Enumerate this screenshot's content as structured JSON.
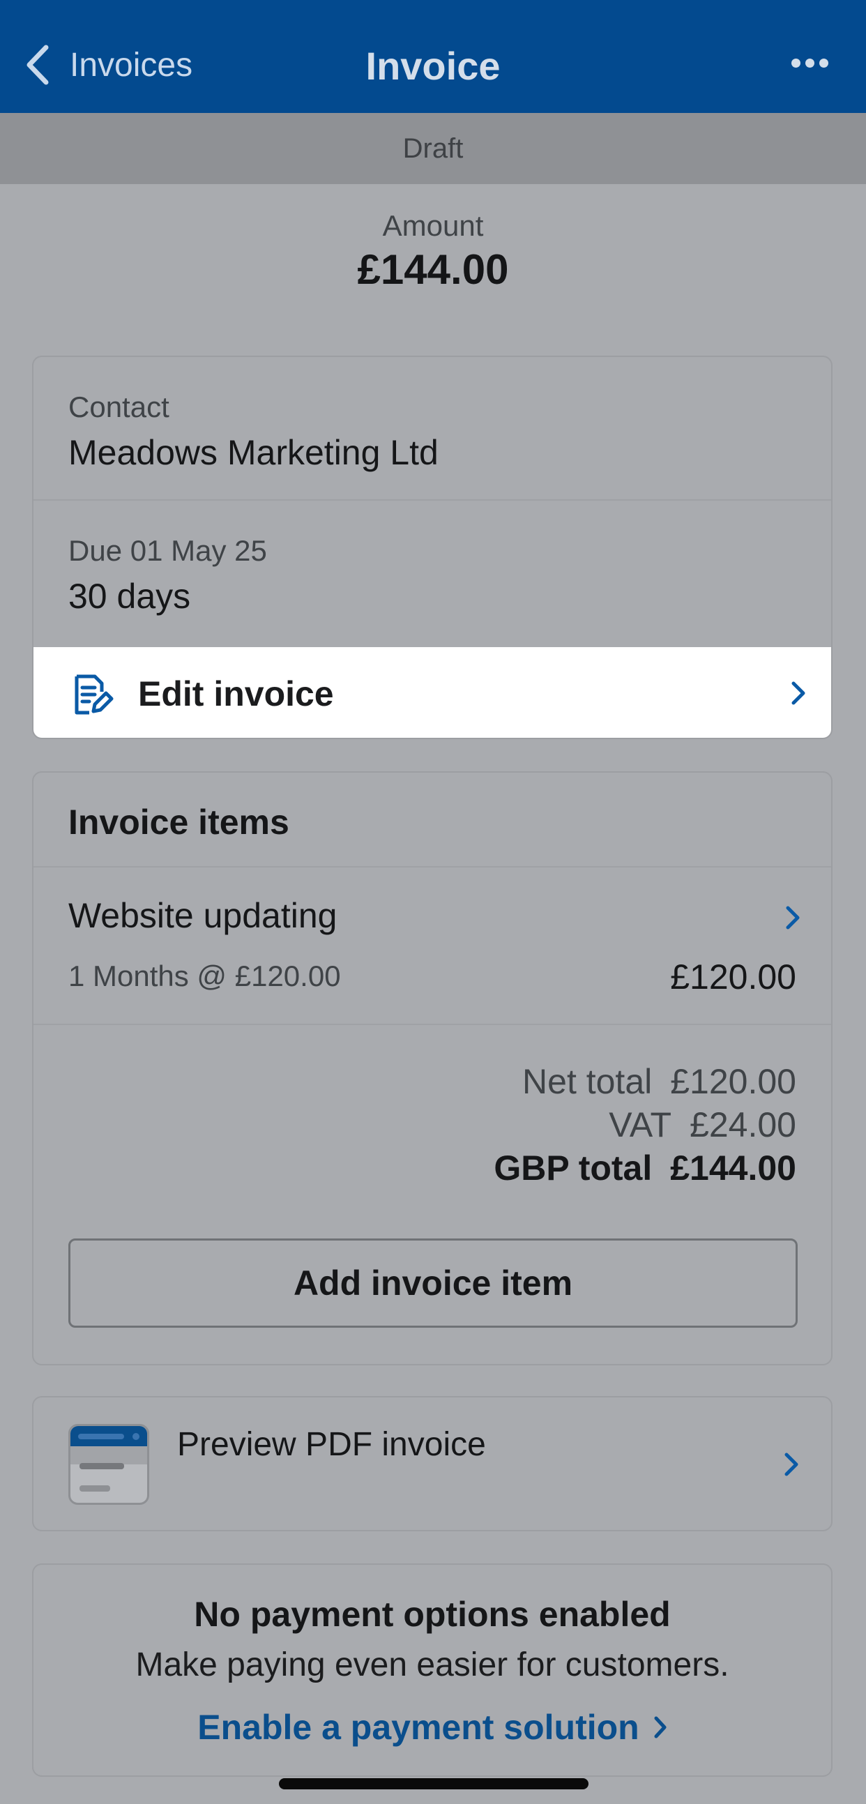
{
  "nav": {
    "back_label": "Invoices",
    "title": "Invoice"
  },
  "status": "Draft",
  "amount": {
    "label": "Amount",
    "value": "£144.00"
  },
  "contact": {
    "label": "Contact",
    "value": "Meadows Marketing Ltd"
  },
  "due": {
    "label": "Due 01 May 25",
    "value": "30 days"
  },
  "edit_invoice_label": "Edit invoice",
  "items": {
    "title": "Invoice items",
    "list": [
      {
        "name": "Website updating",
        "detail": "1 Months @ £120.00",
        "amount": "£120.00"
      }
    ],
    "totals": {
      "net_label": "Net total",
      "net_value": "£120.00",
      "vat_label": "VAT",
      "vat_value": "£24.00",
      "gbp_label": "GBP total",
      "gbp_value": "£144.00"
    },
    "add_button": "Add invoice item"
  },
  "preview_label": "Preview PDF invoice",
  "payment": {
    "title": "No payment options enabled",
    "subtitle": "Make paying even easier for customers.",
    "link": "Enable a payment solution"
  },
  "icons": {
    "back": "chevron-left-icon",
    "more": "more-horizontal-icon",
    "edit": "edit-document-icon",
    "chevron": "chevron-right-icon",
    "pdf": "pdf-preview-thumbnail"
  },
  "colors": {
    "nav_bg": "#034a8f",
    "accent": "#0a4e8c",
    "overlay_bg": "#a9abaf"
  }
}
